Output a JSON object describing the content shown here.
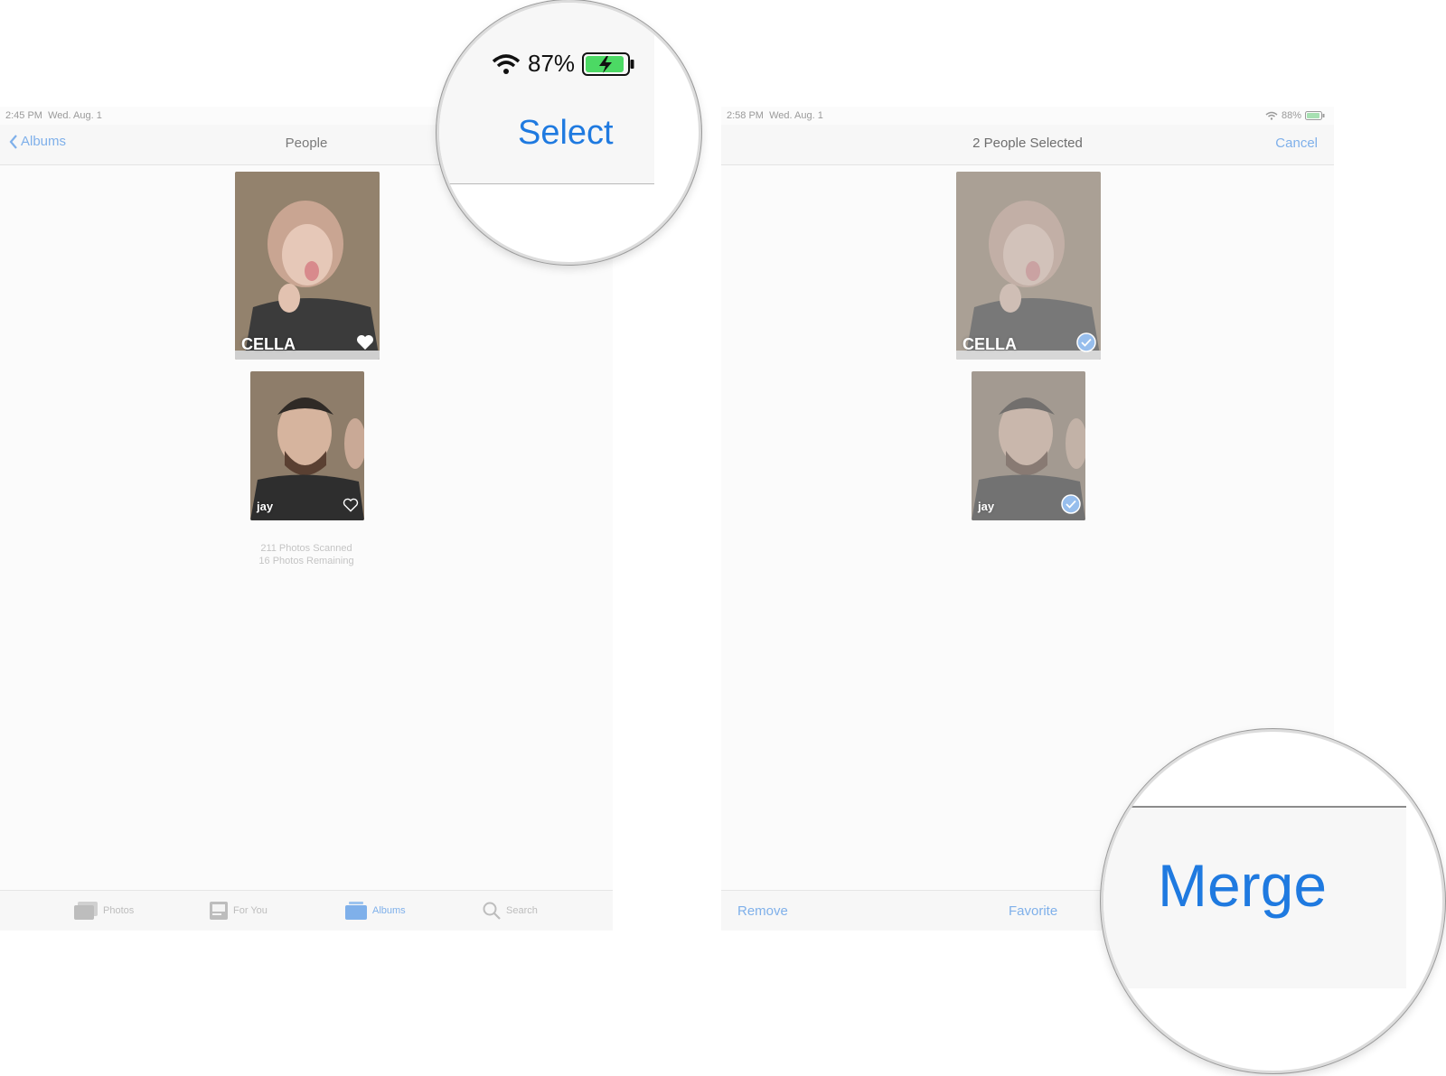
{
  "left_screen": {
    "status": {
      "time": "2:45 PM",
      "date": "Wed. Aug. 1"
    },
    "nav": {
      "back_label": "Albums",
      "title": "People"
    },
    "people": [
      {
        "name": "CELLA",
        "favorite": true
      },
      {
        "name": "jay",
        "favorite": false
      }
    ],
    "scan": {
      "scanned": "211 Photos Scanned",
      "remaining": "16 Photos Remaining"
    },
    "tabs": [
      {
        "label": "Photos",
        "icon": "photos-icon",
        "active": false
      },
      {
        "label": "For You",
        "icon": "for-you-icon",
        "active": false
      },
      {
        "label": "Albums",
        "icon": "albums-icon",
        "active": true
      },
      {
        "label": "Search",
        "icon": "search-icon",
        "active": false
      }
    ]
  },
  "magnifier_select": {
    "battery": "87%",
    "select_label": "Select"
  },
  "right_screen": {
    "status": {
      "time": "2:58 PM",
      "date": "Wed. Aug. 1",
      "battery": "88%"
    },
    "nav": {
      "title": "2 People Selected",
      "cancel_label": "Cancel"
    },
    "people": [
      {
        "name": "CELLA",
        "selected": true
      },
      {
        "name": "jay",
        "selected": true
      }
    ],
    "toolbar": {
      "remove_label": "Remove",
      "favorite_label": "Favorite"
    }
  },
  "magnifier_merge": {
    "merge_label": "Merge"
  },
  "colors": {
    "accent": "#1f7ae0",
    "accent_faded": "#7fb0ea",
    "battery_green": "#4cd964"
  }
}
